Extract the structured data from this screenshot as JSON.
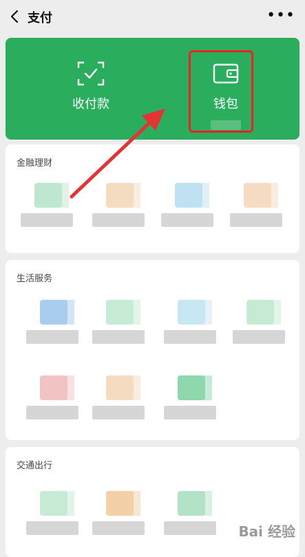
{
  "header": {
    "title": "支付"
  },
  "green_panel": {
    "items": [
      {
        "label": "收付款",
        "icon": "scan-check-icon"
      },
      {
        "label": "钱包",
        "icon": "wallet-icon"
      }
    ],
    "color": "#2aad5c"
  },
  "sections": [
    {
      "title": "金融理财",
      "tiles": [
        {
          "color": "#bfe6cf"
        },
        {
          "color": "#f4dcc0"
        },
        {
          "color": "#bfe2f2"
        },
        {
          "color": "#f6dcc2"
        }
      ]
    },
    {
      "title": "生活服务",
      "tiles": [
        {
          "color": "#a9cdee"
        },
        {
          "color": "#c7ecd6"
        },
        {
          "color": "#c8e7f4"
        },
        {
          "color": "#c6ebd3"
        },
        {
          "color": "#f1c3c3"
        },
        {
          "color": "#f5dcc1"
        },
        {
          "color": "#8fd7ad"
        }
      ]
    },
    {
      "title": "交通出行",
      "tiles": [
        {
          "color": "#c6ead4"
        },
        {
          "color": "#f2d1a8"
        },
        {
          "color": "#b3e3c6"
        }
      ]
    }
  ],
  "watermark": "Bai 经验",
  "colors": {
    "highlight": "#e22222",
    "arrow": "#e53333"
  }
}
